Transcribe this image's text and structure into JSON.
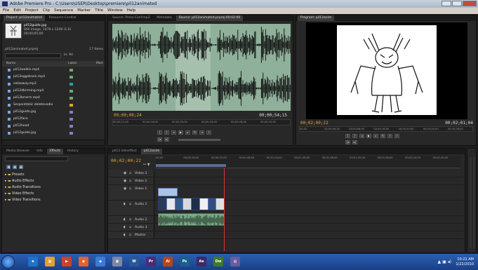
{
  "titlebar": {
    "text": "Adobe Premiere Pro - C:\\Users\\USER\\Desktop\\premiere\\pil12animated"
  },
  "menu": {
    "items": [
      "File",
      "Edit",
      "Project",
      "Clip",
      "Sequence",
      "Marker",
      "Title",
      "Window",
      "Help"
    ]
  },
  "project_panel": {
    "tabs": [
      "Project: pil12animated",
      "Resource Central"
    ],
    "clip_info": {
      "name": "pil12guide.jpg",
      "type": "Still Image, 1478 x 1249 (1.0)",
      "duration": "00;00;05;00"
    },
    "project_file": "pil12animated.prproj",
    "item_count": "17 Items",
    "in_label": "In:",
    "in_value": "All",
    "columns": {
      "name": "Name",
      "label": "Label",
      "media": "Med"
    },
    "items": [
      {
        "name": "pil12walkin.mp4",
        "color": "#6fa86a"
      },
      {
        "name": "pil12eggsbrain.mp4",
        "color": "#6fa86a"
      },
      {
        "name": "eataaway.mp3",
        "color": "#2f9f8f"
      },
      {
        "name": "pil12dbrrming.mp4",
        "color": "#6fa86a"
      },
      {
        "name": "pil12brrorm.mp4",
        "color": "#6fa86a"
      },
      {
        "name": "Serpentdelic deletevedio",
        "color": "#d9a52c"
      },
      {
        "name": "pil12guide.jpg",
        "color": "#8a7ac8"
      },
      {
        "name": "pil12face",
        "color": "#8a7ac8"
      },
      {
        "name": "pil12head",
        "color": "#8a7ac8"
      },
      {
        "name": "pil12guide.jpg",
        "color": "#8a7ac8"
      }
    ]
  },
  "source_panel": {
    "tabs": [
      "Source: Press-Conf.mp3",
      "Metadata",
      "Source: pil12animated.prproj:00:02:09"
    ],
    "timecode_in": "00;00;08;24",
    "timecode_out": "00;00;54;15",
    "ruler": [
      "00;00;12;00",
      "00;00;16;00",
      "00;00;20;00",
      "00;00;24;00",
      "00;00;28;00",
      "00;00;32;00"
    ]
  },
  "program_panel": {
    "tabs": [
      "Program: pil12anim"
    ],
    "timecode_in": "00;02;00;22",
    "timecode_out": "00;02;01;04",
    "ruler": [
      "00;00",
      "00;00;04;00",
      "00;00;08;00",
      "00;00;16;00",
      "00;00;20;00",
      "00;00;24;00",
      "00;00;28;00"
    ]
  },
  "effects_panel": {
    "tabs": [
      "Media Browser",
      "Info",
      "Effects",
      "History"
    ],
    "folders": [
      "Presets",
      "Audio Effects",
      "Audio Transitions",
      "Video Effects",
      "Video Transitions"
    ]
  },
  "timeline_panel": {
    "tabs": [
      "pil12 Inlineffect",
      "pil12anim"
    ],
    "timecode": "00;02;00;22",
    "ruler": [
      "00;00",
      "00;00;16;00",
      "00;00;32;00",
      "00;00;48;00",
      "00;01;04;00",
      "00;01;20;00",
      "00;01;36;00",
      "00;01;52;00",
      "00;02;08;00",
      "00;02;24;00",
      "00;02;40;00"
    ],
    "tracks": [
      {
        "label": "Video 3",
        "kind": "video"
      },
      {
        "label": "Video 2",
        "kind": "video"
      },
      {
        "label": "Video 1",
        "kind": "video"
      },
      {
        "label": "Audio 1",
        "kind": "audio"
      },
      {
        "label": "Audio 2",
        "kind": "audio"
      },
      {
        "label": "Audio 3",
        "kind": "audio"
      },
      {
        "label": "Master",
        "kind": "master"
      }
    ]
  },
  "taskbar": {
    "apps": [
      {
        "glyph": "e",
        "color": "#1e73c9"
      },
      {
        "glyph": "▦",
        "color": "#e0a12a"
      },
      {
        "glyph": "▶",
        "color": "#d0402a"
      },
      {
        "glyph": "◉",
        "color": "#e6622a"
      },
      {
        "glyph": "◆",
        "color": "#3a7bd5"
      },
      {
        "glyph": "▣",
        "color": "#7a88a8"
      },
      {
        "glyph": "W",
        "color": "#2b579a"
      },
      {
        "glyph": "Pr",
        "color": "#4b2a7a"
      },
      {
        "glyph": "Ai",
        "color": "#b5451b"
      },
      {
        "glyph": "Ps",
        "color": "#1a5e8f"
      },
      {
        "glyph": "Ae",
        "color": "#3b2a6a"
      },
      {
        "glyph": "Dw",
        "color": "#3f7a2a"
      },
      {
        "glyph": "▤",
        "color": "#6a5aa0"
      }
    ],
    "clock_time": "10:21 AM",
    "clock_date": "1/22/2010"
  }
}
